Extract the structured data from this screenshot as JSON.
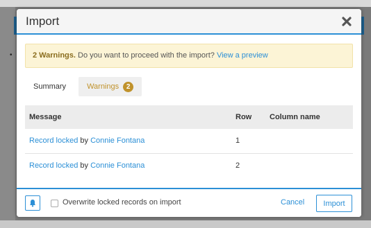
{
  "dialog": {
    "title": "Import"
  },
  "alert": {
    "strong": "2 Warnings.",
    "text": " Do you want to proceed with the import? ",
    "link": "View a preview"
  },
  "tabs": [
    {
      "label": "Summary"
    },
    {
      "label": "Warnings",
      "badge": "2"
    }
  ],
  "table": {
    "columns": [
      "Message",
      "Row",
      "Column name"
    ],
    "rows": [
      {
        "message_link": "Record locked",
        "by": " by ",
        "user": "Connie Fontana",
        "row": "1",
        "column": ""
      },
      {
        "message_link": "Record locked",
        "by": " by ",
        "user": "Connie Fontana",
        "row": "2",
        "column": ""
      }
    ]
  },
  "footer": {
    "checkbox_label": "Overwrite locked records on import",
    "cancel_label": "Cancel",
    "import_label": "Import"
  },
  "colors": {
    "accent": "#2b8fd6",
    "warning_bg": "#fcf4d6",
    "warning_badge": "#c0922b"
  },
  "icons": {
    "close": "close-icon",
    "bell": "bell-icon"
  }
}
